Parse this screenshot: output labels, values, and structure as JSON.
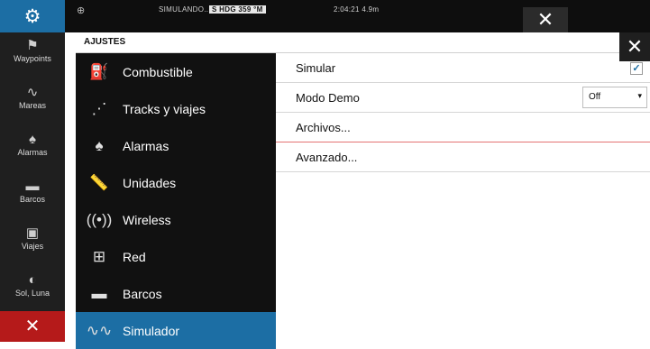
{
  "topbar": {
    "simulating": "SIMULANDO...",
    "heading": "S HDG 359 °M",
    "clock": "2:04:21  4.9m",
    "close": "✕"
  },
  "sidebar": {
    "items": [
      {
        "label": "Waypoints",
        "icon": "flag-icon"
      },
      {
        "label": "Mareas",
        "icon": "tide-icon"
      },
      {
        "label": "Alarmas",
        "icon": "bell-icon"
      },
      {
        "label": "Barcos",
        "icon": "ship-icon"
      },
      {
        "label": "Viajes",
        "icon": "trip-icon"
      },
      {
        "label": "Sol, Luna",
        "icon": "sun-moon-icon"
      }
    ],
    "close": "✕"
  },
  "dialog": {
    "title": "AJUSTES",
    "close": "✕",
    "menu": [
      {
        "label": "Combustible",
        "icon": "fuel-icon"
      },
      {
        "label": "Tracks y viajes",
        "icon": "tracks-icon"
      },
      {
        "label": "Alarmas",
        "icon": "bell-icon"
      },
      {
        "label": "Unidades",
        "icon": "ruler-icon"
      },
      {
        "label": "Wireless",
        "icon": "wireless-icon"
      },
      {
        "label": "Red",
        "icon": "network-icon"
      },
      {
        "label": "Barcos",
        "icon": "ship-icon"
      },
      {
        "label": "Simulador",
        "icon": "simulator-icon",
        "selected": true
      }
    ],
    "settings": [
      {
        "label": "Simular",
        "control": "checkbox",
        "checked": true
      },
      {
        "label": "Modo Demo",
        "control": "dropdown",
        "value": "Off"
      },
      {
        "label": "Archivos..."
      },
      {
        "label": "Avanzado..."
      }
    ]
  },
  "colors": {
    "accent": "#1c6ea4",
    "alert": "#b51a1a"
  }
}
